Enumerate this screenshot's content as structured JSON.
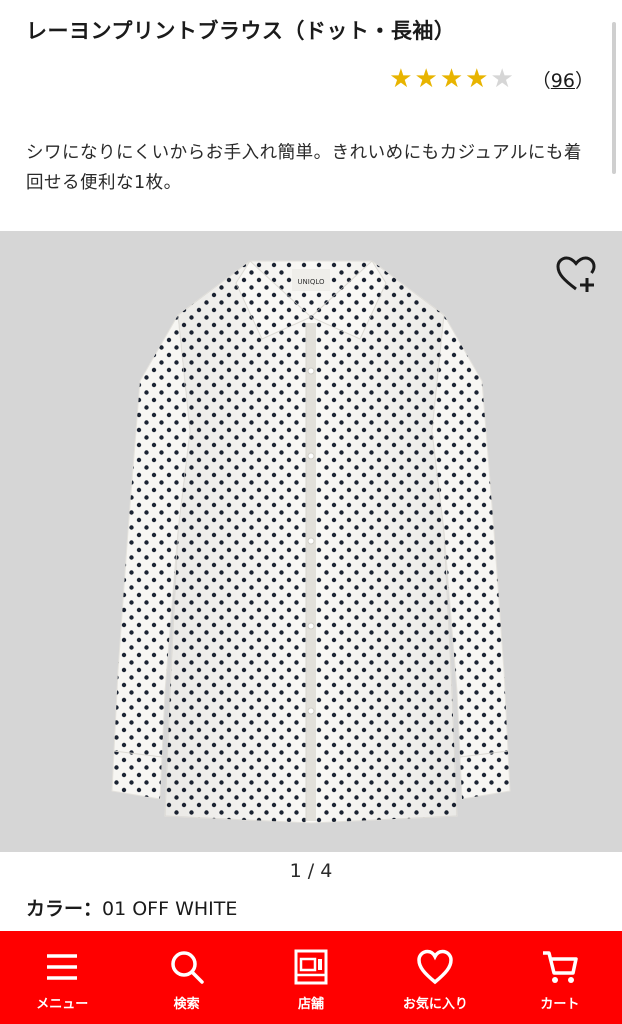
{
  "product": {
    "title": "レーヨンプリントブラウス（ドット・長袖）",
    "rating": 4,
    "rating_max": 5,
    "review_count": "96",
    "review_open": "（",
    "review_close": "）",
    "description": "シワになりにくいからお手入れ簡単。きれいめにもカジュアルにも着回せる便利な1枚。"
  },
  "gallery": {
    "pager": "1 / 4",
    "brand_tag": "UNIQLO"
  },
  "color": {
    "label": "カラー：",
    "value": "01 OFF WHITE"
  },
  "nav": {
    "items": [
      {
        "label": "メニュー",
        "icon": "menu-icon"
      },
      {
        "label": "検索",
        "icon": "search-icon"
      },
      {
        "label": "店舗",
        "icon": "store-icon"
      },
      {
        "label": "お気に入り",
        "icon": "heart-icon"
      },
      {
        "label": "カート",
        "icon": "cart-icon"
      }
    ]
  },
  "colors": {
    "accent": "#ff0000",
    "star": "#e8b400",
    "image_bg": "#d6d6d6"
  }
}
